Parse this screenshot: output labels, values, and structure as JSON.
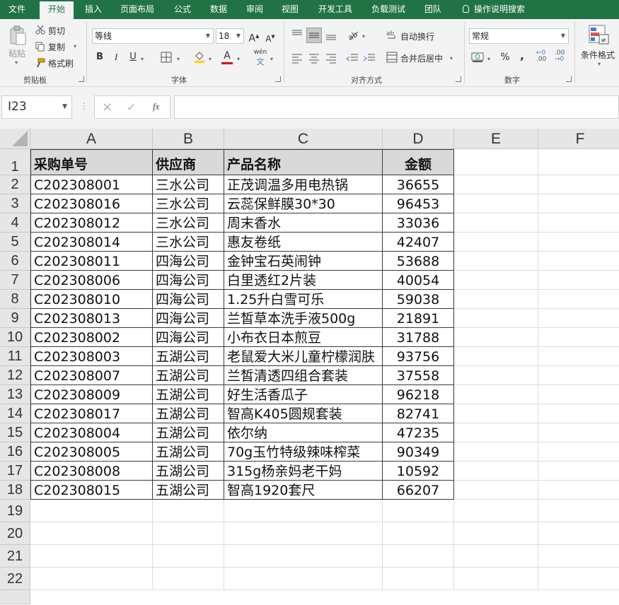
{
  "menu": {
    "tabs": [
      "文件",
      "开始",
      "插入",
      "页面布局",
      "公式",
      "数据",
      "审阅",
      "视图",
      "开发工具",
      "负载测试",
      "团队"
    ],
    "active": "开始",
    "tell_me": "操作说明搜索"
  },
  "ribbon": {
    "clipboard": {
      "paste": "粘贴",
      "cut": "剪切",
      "copy": "复制",
      "format_painter": "格式刷",
      "label": "剪贴板"
    },
    "font": {
      "name": "等线",
      "size": "18",
      "bold": "B",
      "italic": "I",
      "underline": "U",
      "grow": "A",
      "shrink": "A",
      "font_color": "A",
      "phonetic": "wén",
      "label": "字体"
    },
    "alignment": {
      "wrap_text": "自动换行",
      "merge_center": "合并后居中",
      "label": "对齐方式"
    },
    "number": {
      "format": "常规",
      "percent": "%",
      "comma": ",",
      "inc_decimal": ".00",
      "dec_decimal": ".00",
      "label": "数字"
    },
    "styles": {
      "conditional_formatting": "条件格式"
    }
  },
  "formula_bar": {
    "name_box": "I23",
    "cancel": "×",
    "enter": "✓",
    "fx": "fx",
    "formula": ""
  },
  "grid": {
    "columns": [
      "A",
      "B",
      "C",
      "D",
      "E",
      "F"
    ],
    "row_numbers": [
      "1",
      "2",
      "3",
      "4",
      "5",
      "6",
      "7",
      "8",
      "9",
      "10",
      "11",
      "12",
      "13",
      "14",
      "15",
      "16",
      "17",
      "18",
      "19",
      "20",
      "21",
      "22"
    ],
    "headers": [
      "采购单号",
      "供应商",
      "产品名称",
      "金额"
    ],
    "rows": [
      [
        "C202308001",
        "三水公司",
        "正茂调温多用电热锅",
        "36655"
      ],
      [
        "C202308016",
        "三水公司",
        "云蕊保鲜膜30*30",
        "96453"
      ],
      [
        "C202308012",
        "三水公司",
        "周末香水",
        "33036"
      ],
      [
        "C202308014",
        "三水公司",
        "惠友卷纸",
        "42407"
      ],
      [
        "C202308011",
        "四海公司",
        "金钟宝石英闹钟",
        "53688"
      ],
      [
        "C202308006",
        "四海公司",
        "白里透红2片装",
        "40054"
      ],
      [
        "C202308010",
        "四海公司",
        "1.25升白雪可乐",
        "59038"
      ],
      [
        "C202308013",
        "四海公司",
        "兰皙草本洗手液500g",
        "21891"
      ],
      [
        "C202308002",
        "四海公司",
        "小布衣日本煎豆",
        "31788"
      ],
      [
        "C202308003",
        "五湖公司",
        "老鼠爱大米儿童柠檬润肤",
        "93756"
      ],
      [
        "C202308007",
        "五湖公司",
        "兰皙清透四组合套装",
        "37558"
      ],
      [
        "C202308009",
        "五湖公司",
        "好生活香瓜子",
        "96218"
      ],
      [
        "C202308017",
        "五湖公司",
        "智高K405圆规套装",
        "82741"
      ],
      [
        "C202308004",
        "五湖公司",
        "依尔纳",
        "47235"
      ],
      [
        "C202308005",
        "五湖公司",
        "70g玉竹特级辣味榨菜",
        "90349"
      ],
      [
        "C202308008",
        "五湖公司",
        "315g杨亲妈老干妈",
        "10592"
      ],
      [
        "C202308015",
        "五湖公司",
        "智高1920套尺",
        "66207"
      ]
    ]
  }
}
